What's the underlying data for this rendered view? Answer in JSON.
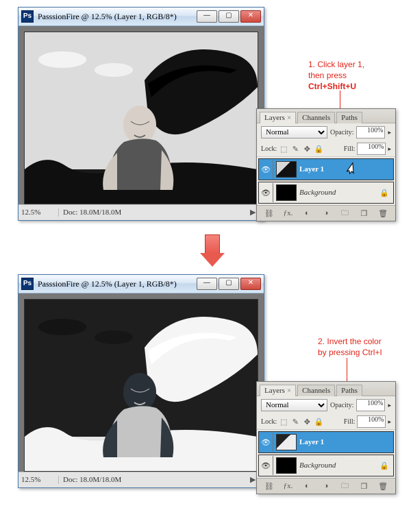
{
  "step1": {
    "window": {
      "title": "PasssionFire @ 12.5% (Layer 1, RGB/8*)",
      "zoom": "12.5%",
      "docinfo": "Doc: 18.0M/18.0M"
    },
    "callout": {
      "num": "1.",
      "line1": "Click layer 1,",
      "line2": "then press",
      "line3": "Ctrl+Shift+U"
    }
  },
  "step2": {
    "window": {
      "title": "PasssionFire @ 12.5% (Layer 1, RGB/8*)",
      "zoom": "12.5%",
      "docinfo": "Doc: 18.0M/18.0M"
    },
    "callout": {
      "num": "2.",
      "line1": "Invert the color",
      "line2": "by pressing Ctrl+I"
    }
  },
  "panel": {
    "tabs": [
      "Layers",
      "Channels",
      "Paths"
    ],
    "blend": "Normal",
    "opacity_label": "Opacity:",
    "opacity": "100%",
    "lock_label": "Lock:",
    "fill_label": "Fill:",
    "fill": "100%",
    "layer1": "Layer 1",
    "background": "Background"
  },
  "winbtns": {
    "min": "—",
    "max": "▢",
    "close": "✕"
  },
  "ps": "Ps"
}
